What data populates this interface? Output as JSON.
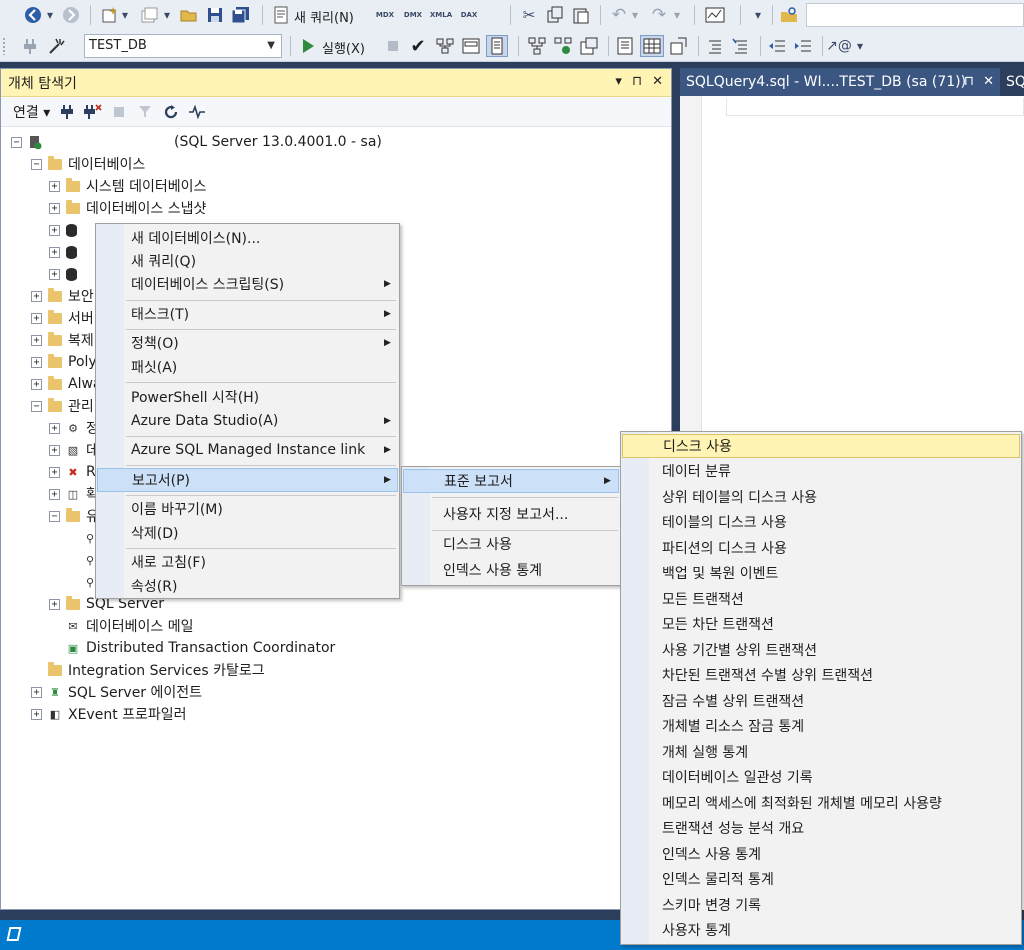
{
  "toolbar": {
    "new_query_label": "새 쿼리(N)",
    "mdx_label": "MDX",
    "dmx_label": "DMX",
    "xmla_label": "XMLA",
    "dax_label": "DAX",
    "database_value": "TEST_DB",
    "execute_label": "실행(X)"
  },
  "object_explorer": {
    "title": "개체 탐색기",
    "connect_label": "연결",
    "tree": {
      "server": "(SQL Server 13.0.4001.0 - sa)",
      "databases": "데이터베이스",
      "system_databases": "시스템 데이터베이스",
      "database_snapshots": "데이터베이스 스냅샷",
      "security": "보안",
      "server_objects": "서버",
      "replication": "복제",
      "polybase": "Poly",
      "always_on": "Alwa",
      "management": "관리",
      "mgmt_child1": "정",
      "mgmt_child2": "데",
      "mgmt_child3": "Re",
      "mgmt_child4": "확",
      "mgmt_child5": "유",
      "sql_server_logs": "SQL Server",
      "database_mail": "데이터베이스 메일",
      "dtc": "Distributed Transaction Coordinator",
      "integration_services": "Integration Services 카탈로그",
      "sql_server_agent": "SQL Server 에이전트",
      "xevent_profiler": "XEvent 프로파일러"
    }
  },
  "editor": {
    "tab_title": "SQLQuery4.sql - WI....TEST_DB (sa (71))",
    "tab_next": "SQ"
  },
  "context_menu": {
    "items": [
      {
        "label": "새 데이터베이스(N)..."
      },
      {
        "label": "새 쿼리(Q)"
      },
      {
        "label": "데이터베이스 스크립팅(S)"
      },
      {
        "label": "태스크(T)"
      },
      {
        "label": "정책(O)"
      },
      {
        "label": "패싯(A)"
      },
      {
        "label": "PowerShell 시작(H)"
      },
      {
        "label": "Azure Data Studio(A)"
      },
      {
        "label": "Azure SQL Managed Instance link"
      },
      {
        "label": "보고서(P)"
      },
      {
        "label": "이름 바꾸기(M)"
      },
      {
        "label": "삭제(D)"
      },
      {
        "label": "새로 고침(F)"
      },
      {
        "label": "속성(R)"
      }
    ]
  },
  "reports_menu": {
    "items": [
      {
        "label": "표준 보고서"
      },
      {
        "label": "사용자 지정 보고서..."
      },
      {
        "label": "디스크 사용"
      },
      {
        "label": "인덱스 사용 통계"
      }
    ]
  },
  "standard_reports_menu": {
    "items": [
      {
        "label": "디스크 사용"
      },
      {
        "label": "데이터 분류"
      },
      {
        "label": "상위 테이블의 디스크 사용"
      },
      {
        "label": "테이블의 디스크 사용"
      },
      {
        "label": "파티션의 디스크 사용"
      },
      {
        "label": "백업 및 복원 이벤트"
      },
      {
        "label": "모든 트랜잭션"
      },
      {
        "label": "모든 차단 트랜잭션"
      },
      {
        "label": "사용 기간별 상위 트랜잭션"
      },
      {
        "label": "차단된 트랜잭션 수별 상위 트랜잭션"
      },
      {
        "label": "잠금 수별 상위 트랜잭션"
      },
      {
        "label": "개체별 리소스 잠금 통계"
      },
      {
        "label": "개체 실행 통계"
      },
      {
        "label": "데이터베이스 일관성 기록"
      },
      {
        "label": "메모리 액세스에 최적화된 개체별 메모리 사용량"
      },
      {
        "label": "트랜잭션 성능 분석 개요"
      },
      {
        "label": "인덱스 사용 통계"
      },
      {
        "label": "인덱스 물리적 통계"
      },
      {
        "label": "스키마 변경 기록"
      },
      {
        "label": "사용자 통계"
      }
    ]
  },
  "colors": {
    "title_highlight": "#fff4b3",
    "menu_highlight": "#cce0f8",
    "status_bar": "#007acc",
    "chrome": "#2b3e5c"
  }
}
